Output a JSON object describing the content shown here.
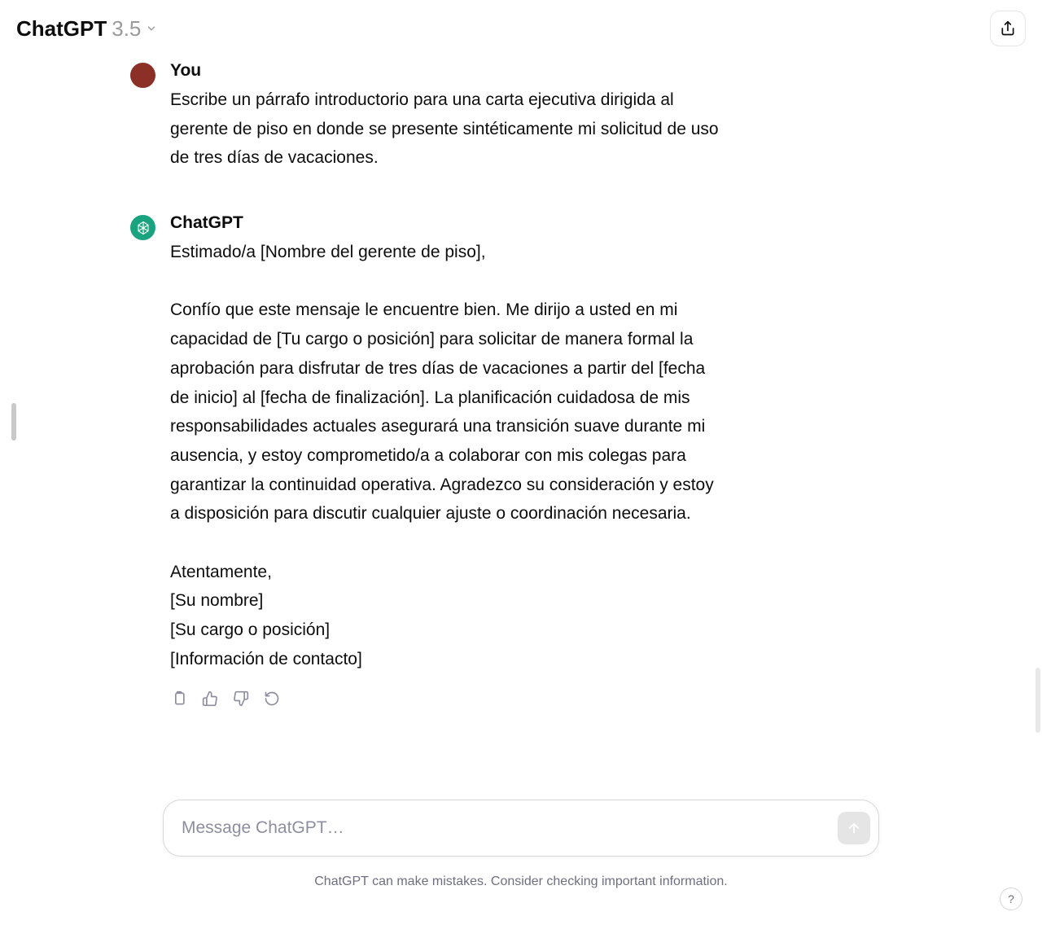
{
  "header": {
    "model_name": "ChatGPT",
    "model_version": "3.5"
  },
  "conversation": {
    "user": {
      "author": "You",
      "text": "Escribe un párrafo introductorio para una carta ejecutiva dirigida al gerente de piso en donde se presente sintéticamente mi solicitud de uso de tres días de vacaciones."
    },
    "assistant": {
      "author": "ChatGPT",
      "text": "Estimado/a [Nombre del gerente de piso],\n\nConfío que este mensaje le encuentre bien. Me dirijo a usted en mi capacidad de [Tu cargo o posición] para solicitar de manera formal la aprobación para disfrutar de tres días de vacaciones a partir del [fecha de inicio] al [fecha de finalización]. La planificación cuidadosa de mis responsabilidades actuales asegurará una transición suave durante mi ausencia, y estoy comprometido/a a colaborar con mis colegas para garantizar la continuidad operativa. Agradezco su consideración y estoy a disposición para discutir cualquier ajuste o coordinación necesaria.\n\nAtentamente,\n[Su nombre]\n[Su cargo o posición]\n[Información de contacto]"
    }
  },
  "input": {
    "placeholder": "Message ChatGPT…"
  },
  "footer": {
    "disclaimer": "ChatGPT can make mistakes. Consider checking important information."
  },
  "help": {
    "label": "?"
  }
}
